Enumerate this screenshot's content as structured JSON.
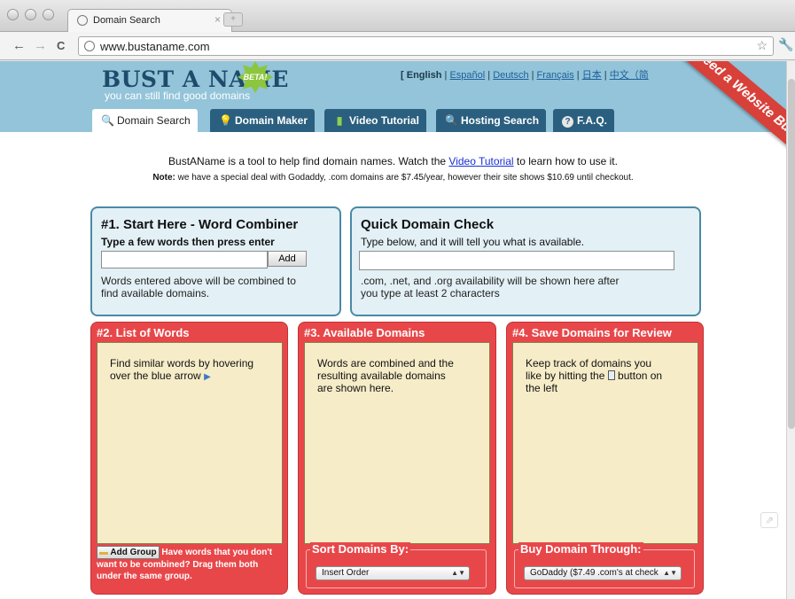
{
  "browser": {
    "tab_title": "Domain Search",
    "tab_close": "×",
    "new_tab": "+",
    "url": "www.bustaname.com",
    "back": "←",
    "forward": "→",
    "reload": "C",
    "star": "☆",
    "wrench": "🔧"
  },
  "header": {
    "logo": "BUST A NAME",
    "beta": "BETA!",
    "tagline": "you can still find good domains",
    "lang_open": "[",
    "lang_current": "English",
    "sep": "|",
    "languages": [
      "Español",
      "Deutsch",
      "Français",
      "日本",
      "中文（简"
    ],
    "ribbon": "Need a Website Built?"
  },
  "nav": [
    {
      "label": "Domain Search",
      "icon": "🔍"
    },
    {
      "label": "Domain Maker",
      "icon": "💡"
    },
    {
      "label": "Video Tutorial",
      "icon": "▮"
    },
    {
      "label": "Hosting Search",
      "icon": "🔍"
    },
    {
      "label": "F.A.Q.",
      "icon": "?"
    }
  ],
  "intro": {
    "before": "BustAName is a tool to help find domain names. Watch the ",
    "link": "Video Tutorial",
    "after": " to learn how to use it.",
    "note_label": "Note:",
    "note_text": " we have a special deal with Godaddy, .com domains are $7.45/year, however their site shows $10.69 until checkout."
  },
  "combiner": {
    "title": "#1. Start Here - Word Combiner",
    "subtitle": "Type a few words then press enter",
    "add_label": "Add",
    "help_line1": "Words entered above will be combined to",
    "help_line2": "find available domains."
  },
  "quick": {
    "title": "Quick Domain Check",
    "subtitle": "Type below, and it will tell you what is available.",
    "help_line1": ".com, .net, and .org availability will be shown here after",
    "help_line2": "you type at least 2 characters"
  },
  "words": {
    "title": "#2. List of Words",
    "text_line1": "Find similar words by hovering",
    "text_line2": "over the blue arrow",
    "add_group": "Add Group",
    "group_line1": " Have words that you don't",
    "group_line2": "want to be combined?  Drag them both",
    "group_line3": "under the same group."
  },
  "available": {
    "title": "#3. Available Domains",
    "text_line1": "Words are combined and the",
    "text_line2": "resulting available domains",
    "text_line3": "are shown here.",
    "sort_legend": "Sort Domains By:",
    "sort_value": "Insert Order"
  },
  "save": {
    "title": "#4. Save Domains for Review",
    "text_line1": "Keep track of domains you",
    "text_line2_a": "like by hitting the ",
    "text_line2_b": " button on",
    "text_line3": "the left",
    "buy_legend": "Buy Domain Through:",
    "buy_value": "GoDaddy ($7.49 .com's at check"
  }
}
